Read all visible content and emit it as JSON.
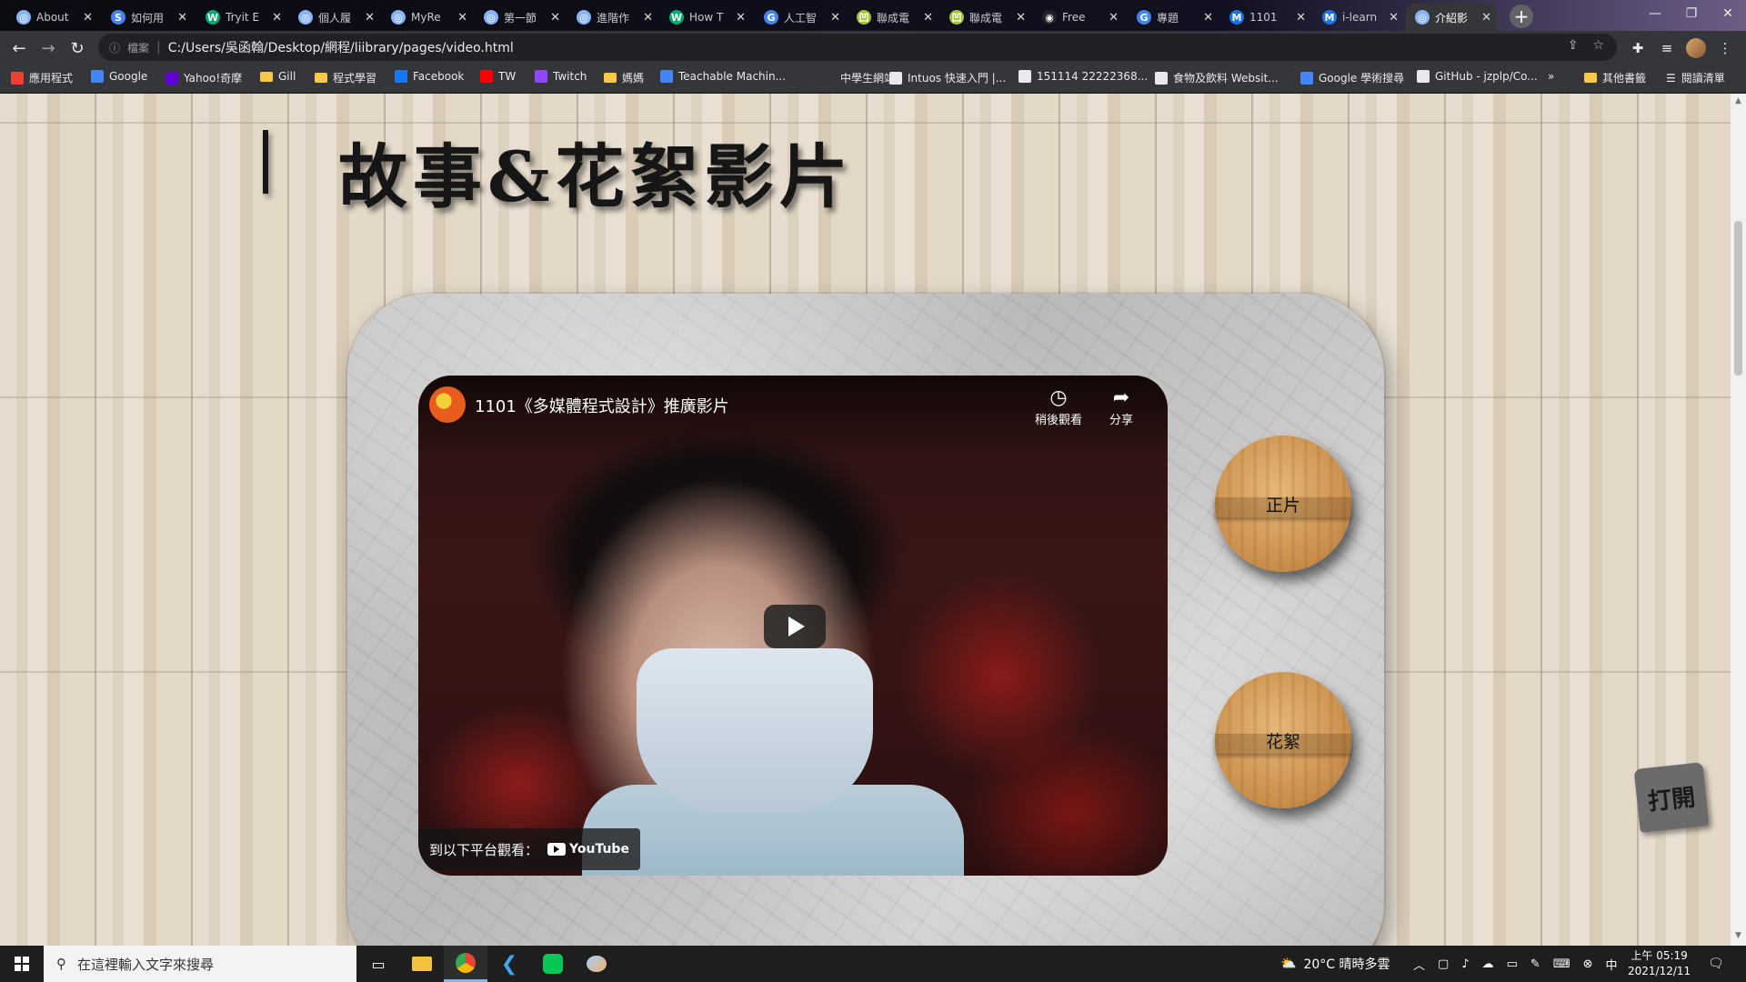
{
  "browser": {
    "tabs": [
      {
        "title": "About",
        "color": "#8ab4f8",
        "glyph": "◎"
      },
      {
        "title": "如何用",
        "color": "#4285f4",
        "glyph": "S"
      },
      {
        "title": "Tryit E",
        "color": "#04aa6d",
        "glyph": "W"
      },
      {
        "title": "個人履",
        "color": "#8ab4f8",
        "glyph": "◎"
      },
      {
        "title": "MyRe",
        "color": "#8ab4f8",
        "glyph": "◎"
      },
      {
        "title": "第一節",
        "color": "#8ab4f8",
        "glyph": "◎"
      },
      {
        "title": "進階作",
        "color": "#8ab4f8",
        "glyph": "◎"
      },
      {
        "title": "How T",
        "color": "#04aa6d",
        "glyph": "W"
      },
      {
        "title": "人工智",
        "color": "#4285f4",
        "glyph": "G"
      },
      {
        "title": "聯成電",
        "color": "#a3c43a",
        "glyph": "凹"
      },
      {
        "title": "聯成電",
        "color": "#a3c43a",
        "glyph": "凹"
      },
      {
        "title": "Free",
        "color": "#222222",
        "glyph": "◉"
      },
      {
        "title": "專題",
        "color": "#4285f4",
        "glyph": "G"
      },
      {
        "title": "1101",
        "color": "#1a73e8",
        "glyph": "M"
      },
      {
        "title": "i-learn",
        "color": "#1a73e8",
        "glyph": "M"
      },
      {
        "title": "介紹影",
        "color": "#8ab4f8",
        "glyph": "◎"
      }
    ],
    "new_tab_label": "+",
    "address": {
      "security_label": "檔案",
      "url": "C:/Users/吳函翰/Desktop/網程/liibrary/pages/video.html"
    }
  },
  "bookmarks": [
    {
      "label": "應用程式",
      "icon": "apps-icon",
      "color": "#ea4335"
    },
    {
      "label": "Google",
      "icon": "google-icon",
      "color": "#4285f4"
    },
    {
      "label": "Yahoo!奇摩",
      "icon": "yahoo-icon",
      "color": "#6001d2"
    },
    {
      "label": "Gill",
      "icon": "folder-icon",
      "color": "#f7c948"
    },
    {
      "label": "程式學習",
      "icon": "folder-icon",
      "color": "#f7c948"
    },
    {
      "label": "Facebook",
      "icon": "facebook-icon",
      "color": "#1877f2"
    },
    {
      "label": "TW",
      "icon": "youtube-icon",
      "color": "#ff0000"
    },
    {
      "label": "Twitch",
      "icon": "twitch-icon",
      "color": "#9146ff"
    },
    {
      "label": "媽媽",
      "icon": "folder-icon",
      "color": "#f7c948"
    },
    {
      "label": "Teachable Machin...",
      "icon": "tm-icon",
      "color": "#4285f4"
    },
    {
      "label": "中學生網站",
      "icon": "site-icon",
      "color": "#35363a"
    },
    {
      "label": "Intuos 快速入門 |...",
      "icon": "wacom-icon",
      "color": "#e8eaed"
    },
    {
      "label": "151114 22222368...",
      "icon": "github-icon",
      "color": "#e8eaed"
    },
    {
      "label": "食物及飲料 Websit...",
      "icon": "site-icon",
      "color": "#e8eaed"
    },
    {
      "label": "Google 學術搜尋",
      "icon": "scholar-icon",
      "color": "#4285f4"
    },
    {
      "label": "GitHub - jzplp/Co...",
      "icon": "github-icon",
      "color": "#e8eaed"
    }
  ],
  "bookmarks_overflow": "»",
  "bookmarks_other": "其他書籤",
  "bookmarks_reading": "閱讀清單",
  "page": {
    "heading": "故事&花絮影片",
    "video": {
      "title": "1101《多媒體程式設計》推廣影片",
      "watch_later": "稍後觀看",
      "share": "分享",
      "watch_on": "到以下平台觀看：",
      "platform": "YouTube"
    },
    "buttons": {
      "main": "正片",
      "extras": "花絮"
    },
    "open_button": "打開"
  },
  "taskbar": {
    "search_placeholder": "在這裡輸入文字來搜尋",
    "weather": "20°C  晴時多雲",
    "time": "上午 05:19",
    "date": "2021/12/11"
  }
}
